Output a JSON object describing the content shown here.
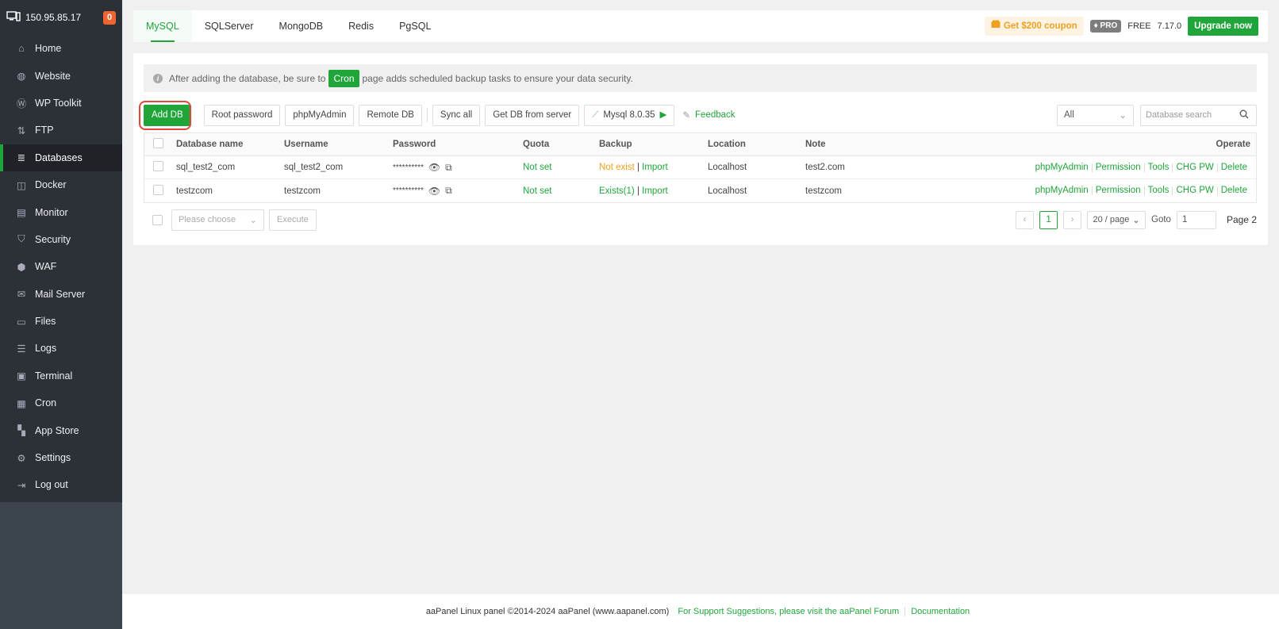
{
  "sidebar": {
    "ip": "150.95.85.17",
    "badge": "0",
    "items": [
      {
        "label": "Home",
        "icon": "home-icon"
      },
      {
        "label": "Website",
        "icon": "globe-icon"
      },
      {
        "label": "WP Toolkit",
        "icon": "wordpress-icon"
      },
      {
        "label": "FTP",
        "icon": "ftp-icon"
      },
      {
        "label": "Databases",
        "icon": "database-icon"
      },
      {
        "label": "Docker",
        "icon": "docker-icon"
      },
      {
        "label": "Monitor",
        "icon": "monitor-icon"
      },
      {
        "label": "Security",
        "icon": "shield-icon"
      },
      {
        "label": "WAF",
        "icon": "waf-icon"
      },
      {
        "label": "Mail Server",
        "icon": "mail-icon"
      },
      {
        "label": "Files",
        "icon": "folder-icon"
      },
      {
        "label": "Logs",
        "icon": "logs-icon"
      },
      {
        "label": "Terminal",
        "icon": "terminal-icon"
      },
      {
        "label": "Cron",
        "icon": "calendar-icon"
      },
      {
        "label": "App Store",
        "icon": "apps-icon"
      },
      {
        "label": "Settings",
        "icon": "gear-icon"
      },
      {
        "label": "Log out",
        "icon": "logout-icon"
      }
    ],
    "active": "Databases"
  },
  "tabs": [
    "MySQL",
    "SQLServer",
    "MongoDB",
    "Redis",
    "PgSQL"
  ],
  "header": {
    "coupon": "Get $200 coupon",
    "pro": "PRO",
    "free": "FREE",
    "version": "7.17.0",
    "upgrade": "Upgrade now"
  },
  "notice": {
    "before": "After adding the database, be sure to",
    "cron": "Cron",
    "after": "page adds scheduled backup tasks to ensure your data security."
  },
  "toolbar": {
    "add_db": "Add DB",
    "root_password": "Root password",
    "phpmyadmin": "phpMyAdmin",
    "remote_db": "Remote DB",
    "sync_all": "Sync all",
    "get_db": "Get DB from server",
    "mysql_version": "Mysql 8.0.35",
    "feedback": "Feedback",
    "filter": "All",
    "search_placeholder": "Database search"
  },
  "table": {
    "headers": {
      "name": "Database name",
      "user": "Username",
      "password": "Password",
      "quota": "Quota",
      "backup": "Backup",
      "location": "Location",
      "note": "Note",
      "operate": "Operate"
    },
    "rows": [
      {
        "name": "sql_test2_com",
        "user": "sql_test2_com",
        "password": "**********",
        "quota": "Not set",
        "backup_status": "Not exist",
        "backup_status_color": "#f0a020",
        "import": "Import",
        "location": "Localhost",
        "note": "test2.com"
      },
      {
        "name": "testzcom",
        "user": "testzcom",
        "password": "**********",
        "quota": "Not set",
        "backup_status": "Exists(1)",
        "backup_status_color": "#20a53a",
        "import": "Import",
        "location": "Localhost",
        "note": "testzcom"
      }
    ],
    "ops": [
      "phpMyAdmin",
      "Permission",
      "Tools",
      "CHG PW",
      "Delete"
    ]
  },
  "bottom": {
    "choose_placeholder": "Please choose",
    "execute": "Execute",
    "current_page": "1",
    "page_size": "20 / page",
    "goto_label": "Goto",
    "goto_value": "1",
    "page_total": "Page 2"
  },
  "footer": {
    "copyright": "aaPanel Linux panel ©2014-2024 aaPanel (www.aapanel.com)",
    "support": "For Support Suggestions, please visit the aaPanel Forum",
    "docs": "Documentation"
  },
  "colors": {
    "accent": "#20a53a",
    "warning": "#f0a020",
    "sidebar": "#3c444d",
    "highlight_ring": "#e0483a"
  }
}
